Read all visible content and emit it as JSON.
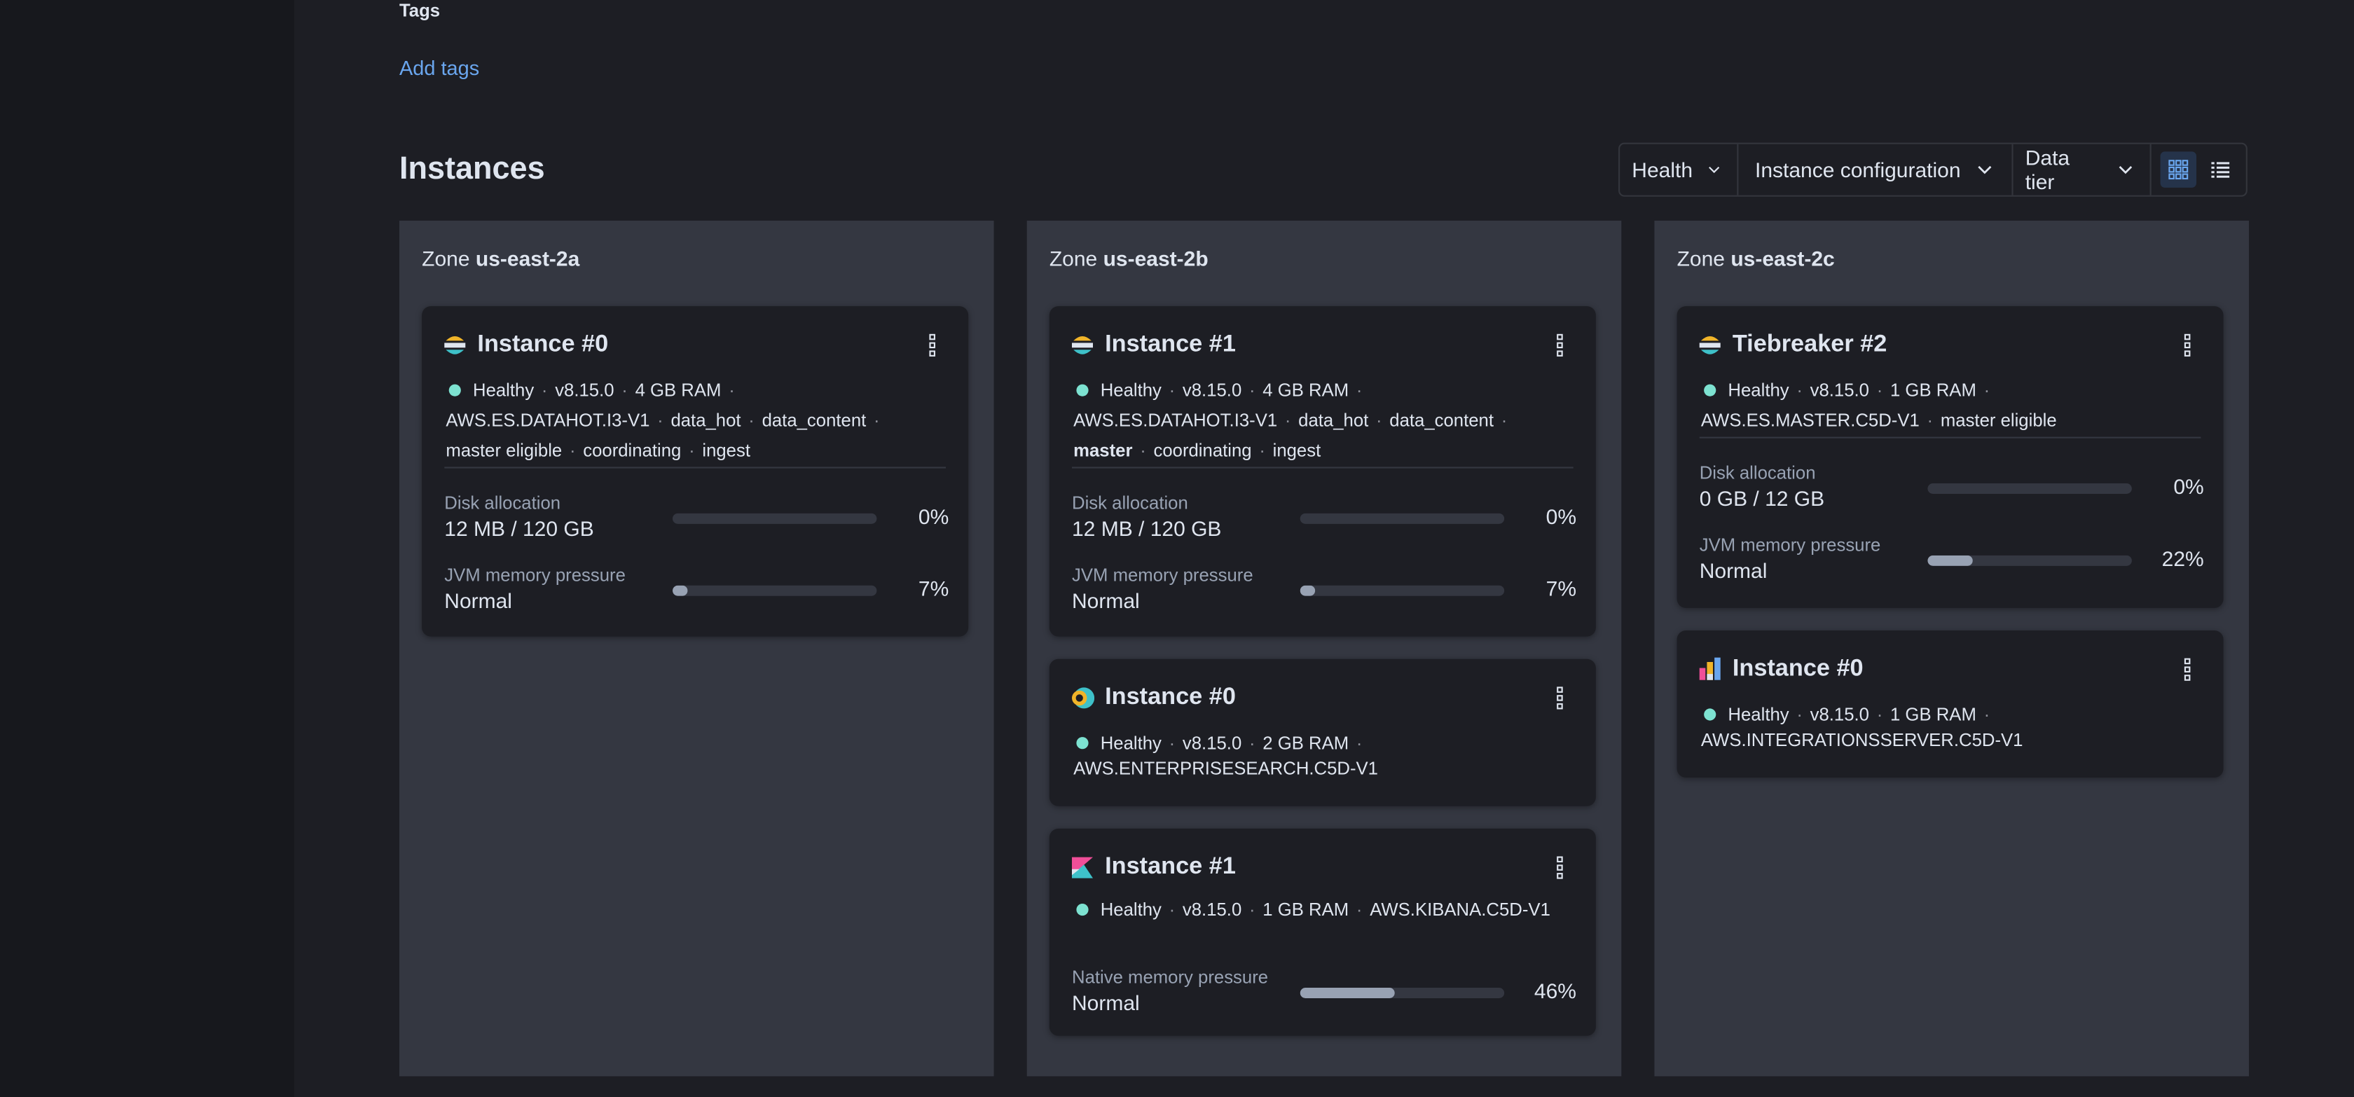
{
  "tags": {
    "label": "Tags",
    "add_link": "Add tags"
  },
  "instances": {
    "title": "Instances",
    "filters": [
      {
        "label": "Health"
      },
      {
        "label": "Instance configuration"
      },
      {
        "label": "Data tier"
      }
    ],
    "view_modes": [
      "grid-view-icon",
      "list-view-icon"
    ],
    "active_view": "grid"
  },
  "zones": [
    {
      "prefix": "Zone",
      "name": "us-east-2a"
    },
    {
      "prefix": "Zone",
      "name": "us-east-2b"
    },
    {
      "prefix": "Zone",
      "name": "us-east-2c"
    }
  ],
  "cards": {
    "a0": {
      "icon": "elasticsearch-icon",
      "title": "Instance #0",
      "status": "Healthy",
      "version": "v8.15.0",
      "ram": "4 GB RAM",
      "config": "AWS.ES.DATAHOT.I3-V1",
      "roles": [
        "data_hot",
        "data_content",
        "master eligible",
        "coordinating",
        "ingest"
      ],
      "disk_label": "Disk allocation",
      "disk_value": "12 MB / 120 GB",
      "disk_pct": "0%",
      "disk_fraction": 0,
      "jvm_label": "JVM memory pressure",
      "jvm_value": "Normal",
      "jvm_pct": "7%",
      "jvm_fraction": 0.07
    },
    "b1": {
      "icon": "elasticsearch-icon",
      "title": "Instance #1",
      "status": "Healthy",
      "version": "v8.15.0",
      "ram": "4 GB RAM",
      "config": "AWS.ES.DATAHOT.I3-V1",
      "roles": [
        "data_hot",
        "data_content",
        "master",
        "coordinating",
        "ingest"
      ],
      "disk_label": "Disk allocation",
      "disk_value": "12 MB / 120 GB",
      "disk_pct": "0%",
      "disk_fraction": 0,
      "jvm_label": "JVM memory pressure",
      "jvm_value": "Normal",
      "jvm_pct": "7%",
      "jvm_fraction": 0.07
    },
    "b0": {
      "icon": "enterprise-search-icon",
      "title": "Instance #0",
      "status": "Healthy",
      "version": "v8.15.0",
      "ram": "2 GB RAM",
      "config": "AWS.ENTERPRISESEARCH.C5D-V1"
    },
    "bk": {
      "icon": "kibana-icon",
      "title": "Instance #1",
      "status": "Healthy",
      "version": "v8.15.0",
      "ram": "1 GB RAM",
      "config": "AWS.KIBANA.C5D-V1",
      "native_label": "Native memory pressure",
      "native_value": "Normal",
      "native_pct": "46%",
      "native_fraction": 0.46
    },
    "c2": {
      "icon": "elasticsearch-icon",
      "title": "Tiebreaker #2",
      "status": "Healthy",
      "version": "v8.15.0",
      "ram": "1 GB RAM",
      "config": "AWS.ES.MASTER.C5D-V1",
      "roles": [
        "master eligible"
      ],
      "disk_label": "Disk allocation",
      "disk_value": "0 GB / 12 GB",
      "disk_pct": "0%",
      "disk_fraction": 0,
      "jvm_label": "JVM memory pressure",
      "jvm_value": "Normal",
      "jvm_pct": "22%",
      "jvm_fraction": 0.22
    },
    "c0": {
      "icon": "integrations-server-icon",
      "title": "Instance #0",
      "status": "Healthy",
      "version": "v8.15.0",
      "ram": "1 GB RAM",
      "config": "AWS.INTEGRATIONSSERVER.C5D-V1"
    }
  },
  "colors": {
    "healthy": "#7de2d1",
    "link": "#6aa6ee",
    "zone_bg": "#343741",
    "card_bg": "#1d1e24"
  }
}
